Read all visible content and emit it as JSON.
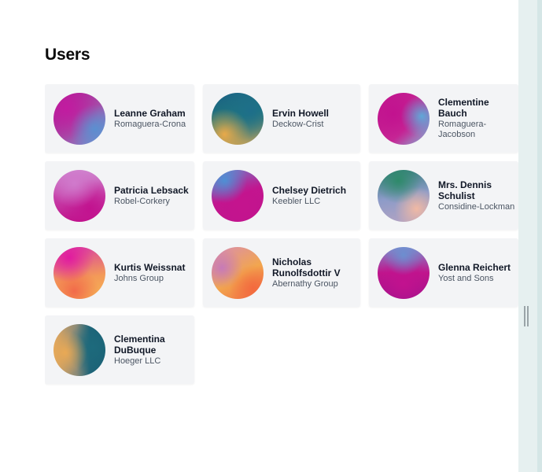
{
  "page": {
    "title": "Users"
  },
  "users": [
    {
      "name": "Leanne Graham",
      "company": "Romaguera-Crona",
      "avatar": "radial-gradient(circle at 80% 70%, #5b8fd0 0%, rgba(91,143,208,0) 45%), radial-gradient(circle at 25% 30%, #c21ba0 0%, rgba(194,27,160,0) 60%), linear-gradient(135deg, #b0128f 0%, #a64ca8 55%, #6aa2d8 100%)"
    },
    {
      "name": "Ervin Howell",
      "company": "Deckow-Crist",
      "avatar": "radial-gradient(circle at 25% 80%, #e8a94a 0%, rgba(232,169,74,0) 45%), radial-gradient(circle at 75% 35%, #1e6e8a 0%, rgba(30,110,138,0) 60%), linear-gradient(160deg, #1b5f86 0%, #1f7a7a 50%, #d4a55a 100%)"
    },
    {
      "name": "Clementine Bauch",
      "company": "Romaguera-Jacobson",
      "avatar": "radial-gradient(circle at 85% 45%, #5fa8d8 0%, rgba(95,168,216,0) 40%), radial-gradient(circle at 30% 40%, #c2128f 0%, rgba(194,18,143,0) 65%), linear-gradient(135deg, #c0148c 0%, #c72a96 60%, #7fb2d6 100%)"
    },
    {
      "name": "Patricia Lebsack",
      "company": "Robel-Corkery",
      "avatar": "radial-gradient(circle at 40% 25%, #d07acc 0%, rgba(208,122,204,0) 50%), radial-gradient(circle at 70% 75%, #c2128f 0%, rgba(194,18,143,0) 55%), linear-gradient(180deg, #cf86cf 0%, #c63fa8 55%, #c0148c 100%)"
    },
    {
      "name": "Chelsey Dietrich",
      "company": "Keebler LLC",
      "avatar": "radial-gradient(circle at 25% 20%, #4f8fd4 0%, rgba(79,143,212,0) 40%), radial-gradient(circle at 60% 70%, #c4148e 0%, rgba(196,20,142,0) 65%), linear-gradient(160deg, #6a86cc 0%, #c2158f 50%, #c0148c 100%)"
    },
    {
      "name": "Mrs. Dennis Schulist",
      "company": "Considine-Lockman",
      "avatar": "radial-gradient(circle at 40% 20%, #2e8a6a 0%, rgba(46,138,106,0) 45%), radial-gradient(circle at 75% 75%, #f0b9a4 0%, rgba(240,185,164,0) 40%), linear-gradient(170deg, #2b7a72 0%, #8c9bc8 50%, #b7a4c2 100%)"
    },
    {
      "name": "Kurtis Weissnat",
      "company": "Johns Group",
      "avatar": "radial-gradient(circle at 30% 20%, #e11aa0 0%, rgba(225,26,160,0) 45%), radial-gradient(circle at 40% 85%, #f26a4a 0%, rgba(242,106,74,0) 45%), linear-gradient(170deg, #d63aa8 0%, #f39a58 60%, #f5b254 100%)"
    },
    {
      "name": "Nicholas Runolfsdottir V",
      "company": "Abernathy Group",
      "avatar": "radial-gradient(circle at 20% 40%, #c77ab8 0%, rgba(199,122,184,0) 40%), radial-gradient(circle at 80% 80%, #f36a3e 0%, rgba(243,106,62,0) 40%), linear-gradient(150deg, #d78cb4 0%, #f2a64e 55%, #f06c44 100%)"
    },
    {
      "name": "Glenna Reichert",
      "company": "Yost and Sons",
      "avatar": "radial-gradient(circle at 50% 15%, #6c8fd0 0%, rgba(108,143,208,0) 40%), radial-gradient(circle at 50% 70%, #c2128f 0%, rgba(194,18,143,0) 60%), linear-gradient(180deg, #7f8ccc 0%, #c0148c 50%, #a0138c 100%)"
    },
    {
      "name": "Clementina DuBuque",
      "company": "Hoeger LLC",
      "avatar": "radial-gradient(circle at 22% 55%, #e9a955 0%, rgba(233,169,85,0) 45%), radial-gradient(circle at 75% 45%, #1d6a7c 0%, rgba(29,106,124,0) 55%), linear-gradient(90deg, #e3a860 0%, #8a8a78 45%, #1e6478 70%, #1a5f74 100%)"
    }
  ]
}
